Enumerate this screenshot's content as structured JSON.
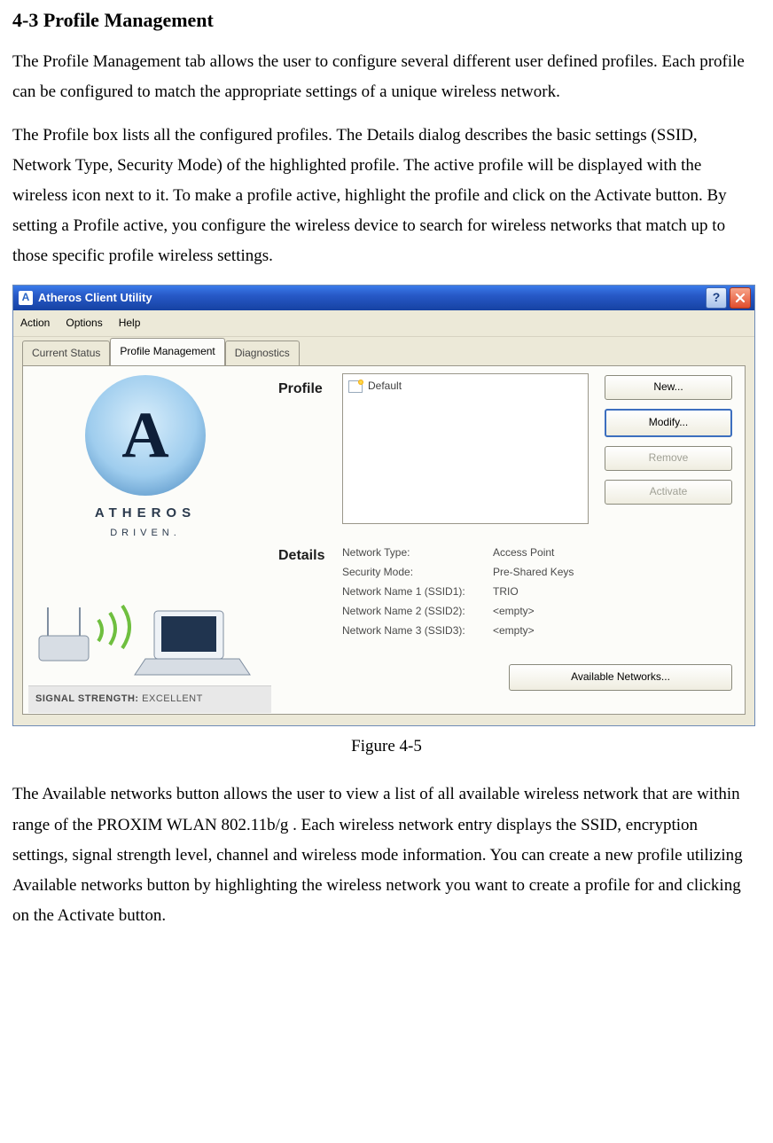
{
  "doc": {
    "section_title": "4-3 Profile Management",
    "para1": "The Profile Management tab allows the user to configure several different user defined profiles.  Each profile can be configured to match the appropriate settings of a unique wireless network.",
    "para2": "The Profile box lists all the configured profiles.  The Details dialog describes the basic settings (SSID, Network Type, Security Mode) of the highlighted profile.  The active profile will be displayed with the wireless icon next to it.  To make a profile active, highlight the profile and click on the Activate button.  By setting a Profile active, you configure the wireless device to search for wireless networks that match up to those specific profile wireless settings.",
    "figure_caption": "Figure 4-5",
    "para3": "The Available networks button allows the user to view a list of all available wireless network that are within range of the PROXIM WLAN 802.11b/g .  Each wireless network entry displays the SSID, encryption settings, signal strength level, channel and wireless mode information.  You can create a new profile utilizing Available networks button by highlighting the wireless network you want to create a profile for and clicking on the Activate button."
  },
  "window": {
    "title": "Atheros Client Utility",
    "menu": [
      "Action",
      "Options",
      "Help"
    ],
    "tabs": [
      {
        "label": "Current Status",
        "active": false
      },
      {
        "label": "Profile Management",
        "active": true
      },
      {
        "label": "Diagnostics",
        "active": false
      }
    ],
    "logo": {
      "letter": "A",
      "brand1": "ATHEROS",
      "brand2": "DRIVEN."
    },
    "signal": {
      "label": "SIGNAL STRENGTH:",
      "value": "EXCELLENT"
    },
    "profile_section_label": "Profile",
    "profile_items": [
      "Default"
    ],
    "buttons": {
      "new": "New...",
      "modify": "Modify...",
      "remove": "Remove",
      "activate": "Activate",
      "available": "Available Networks..."
    },
    "details_section_label": "Details",
    "details": [
      {
        "k": "Network Type:",
        "v": "Access Point"
      },
      {
        "k": "Security Mode:",
        "v": "Pre-Shared Keys"
      },
      {
        "k": "Network Name 1 (SSID1):",
        "v": "TRIO"
      },
      {
        "k": "Network Name 2 (SSID2):",
        "v": "<empty>"
      },
      {
        "k": "Network Name 3 (SSID3):",
        "v": "<empty>"
      }
    ]
  }
}
